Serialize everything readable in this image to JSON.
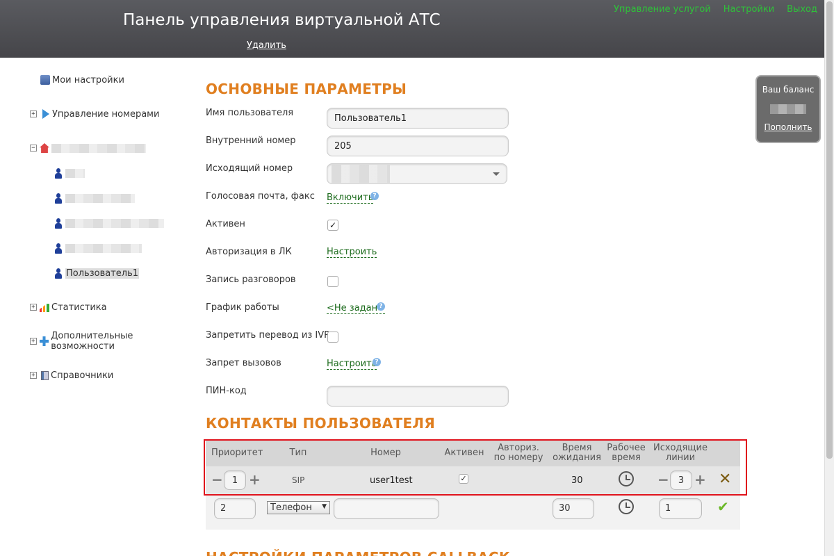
{
  "header": {
    "title": "Панель управления виртуальной АТС",
    "delete_link": "Удалить",
    "nav": [
      "Управление услугой",
      "Настройки",
      "Выход"
    ]
  },
  "sidebar": {
    "my_settings": "Мои настройки",
    "numbers": "Управление номерами",
    "current_user": "Пользователь1",
    "stats": "Статистика",
    "extras": "Дополнительные возможности",
    "directories": "Справочники"
  },
  "main": {
    "section1": "ОСНОВНЫЕ ПАРАМЕТРЫ",
    "fields": {
      "username_label": "Имя пользователя",
      "username_value": "Пользователь1",
      "ext_label": "Внутренний номер",
      "ext_value": "205",
      "outgoing_label": "Исходящий номер",
      "voicemail_label": "Голосовая почта, факс",
      "voicemail_link": "Включить",
      "active_label": "Активен",
      "auth_label": "Авторизация в ЛК",
      "auth_link": "Настроить",
      "record_label": "Запись разговоров",
      "schedule_label": "График работы",
      "schedule_link": "<Не задан>",
      "ivr_label": "Запретить перевод из IVR",
      "ban_label": "Запрет вызовов",
      "ban_link": "Настроить",
      "pin_label": "ПИН-код"
    },
    "section2": "КОНТАКТЫ ПОЛЬЗОВАТЕЛЯ",
    "table": {
      "headers": [
        "Приоритет",
        "Тип",
        "Номер",
        "Активен",
        "Авториз. по номеру",
        "Время ожидания",
        "Рабочее время",
        "Исходящие линии"
      ],
      "row": {
        "priority": "1",
        "type": "SIP",
        "number": "user1test",
        "wait": "30",
        "lines": "3"
      },
      "new_row": {
        "priority": "2",
        "type": "Телефон",
        "wait": "30",
        "lines": "1"
      }
    },
    "section3": "НАСТРОЙКИ ПАРАМЕТРОВ CALLBACK"
  },
  "balance": {
    "title": "Ваш баланс",
    "topup": "Пополнить"
  }
}
